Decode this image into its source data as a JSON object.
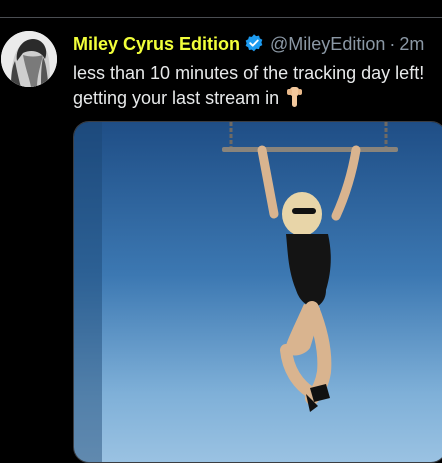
{
  "tweet": {
    "display_name": "Miley Cyrus Edition",
    "handle": "@MileyEdition",
    "separator": "·",
    "time": "2m",
    "text_line1": "less than 10 minutes of the tracking day left!",
    "text_line2": "getting your last stream in",
    "emoji": "point-down-emoji",
    "verified_icon": "verified-badge-icon",
    "media_icon": "photo-of-woman-on-trapeze"
  },
  "colors": {
    "name": "#f2ff3a",
    "muted": "#8b98a5",
    "text": "#e7e9ea",
    "verified": "#1d9bf0",
    "background": "#000000"
  }
}
